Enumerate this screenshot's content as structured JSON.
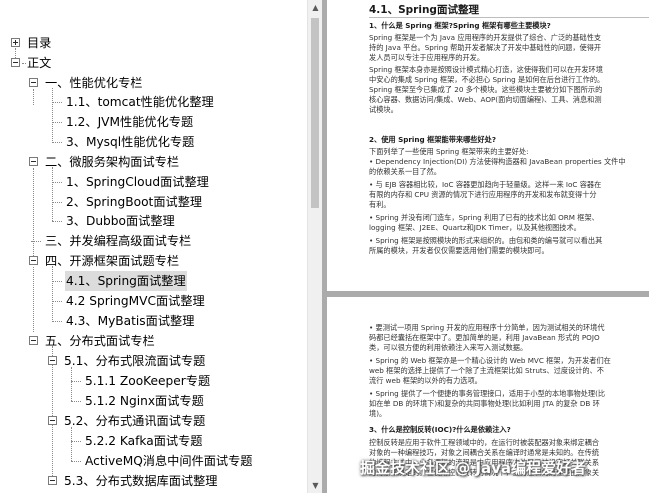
{
  "outline": {
    "items": [
      {
        "label": "目录",
        "expander": "plus",
        "selected": false
      },
      {
        "label": "正文",
        "expander": "minus",
        "selected": false
      },
      {
        "label": "一、性能优化专栏",
        "expander": "minus",
        "selected": false
      },
      {
        "label": "1.1、tomcat性能优化整理",
        "expander": "",
        "selected": false
      },
      {
        "label": "1.2、JVM性能优化专题",
        "expander": "",
        "selected": false
      },
      {
        "label": "3、Mysql性能优化专题",
        "expander": "",
        "selected": false
      },
      {
        "label": "二、微服务架构面试专栏",
        "expander": "minus",
        "selected": false
      },
      {
        "label": "1、SpringCloud面试整理",
        "expander": "",
        "selected": false
      },
      {
        "label": "2、SpringBoot面试整理",
        "expander": "",
        "selected": false
      },
      {
        "label": "3、Dubbo面试整理",
        "expander": "",
        "selected": false
      },
      {
        "label": "三、并发编程高级面试专栏",
        "expander": "",
        "selected": false
      },
      {
        "label": "四、开源框架面试题专栏",
        "expander": "minus",
        "selected": false
      },
      {
        "label": "4.1、Spring面试整理",
        "expander": "",
        "selected": true
      },
      {
        "label": "4.2 SpringMVC面试整理",
        "expander": "",
        "selected": false
      },
      {
        "label": "4.3、MyBatis面试整理",
        "expander": "",
        "selected": false
      },
      {
        "label": "五、分布式面试专栏",
        "expander": "minus",
        "selected": false
      },
      {
        "label": "5.1、分布式限流面试专题",
        "expander": "minus",
        "selected": false
      },
      {
        "label": "5.1.1 ZooKeeper专题",
        "expander": "",
        "selected": false
      },
      {
        "label": "5.1.2 Nginx面试专题",
        "expander": "",
        "selected": false
      },
      {
        "label": "5.2、分布式通讯面试专题",
        "expander": "minus",
        "selected": false
      },
      {
        "label": "5.2.2 Kafka面试专题",
        "expander": "",
        "selected": false
      },
      {
        "label": "ActiveMQ消息中间件面试专题",
        "expander": "",
        "selected": false
      },
      {
        "label": "5.3、分布式数据库面试整理",
        "expander": "minus",
        "selected": false
      }
    ]
  },
  "scrollbar": {
    "up_arrow": "▲",
    "down_arrow": "▼"
  },
  "document": {
    "top_page": {
      "lines": [
        {
          "text": "4.1、Spring面试整理",
          "style": "h1"
        },
        {
          "text": "1、什么是 Spring 框架?Spring 框架有哪些主要模块?",
          "style": "h2"
        },
        {
          "text": "Spring 框架是一个为 Java 应用程序的开发提供了综合、广泛的基础性支",
          "style": ""
        },
        {
          "text": "持的 Java 平台。Spring 帮助开发者解决了开发中基础性的问题，使得开",
          "style": ""
        },
        {
          "text": "发人员可以专注于应用程序的开发。",
          "style": ""
        },
        {
          "text": "Spring 框架本身亦是按照设计模式精心打造，这使得我们可以在开发环境",
          "style": ""
        },
        {
          "text": "中安心的集成 Spring 框架，不必担心 Spring 是如何在后台进行工作的。",
          "style": ""
        },
        {
          "text": "Spring 框架至今已集成了 20 多个模块。这些模块主要被分如下图所示的",
          "style": ""
        },
        {
          "text": "核心容器、数据访问/集成、Web、AOP(面向切面编程)、工具、消息和测",
          "style": ""
        },
        {
          "text": "试模块。",
          "style": ""
        },
        {
          "text": "2、使用 Spring 框架能带来哪些好处?",
          "style": "h2"
        },
        {
          "text": "下面列举了一些使用 Spring 框架带来的主要好处:",
          "style": ""
        },
        {
          "text": "• Dependency Injection(DI) 方法使得构造器和 JavaBean properties 文件中",
          "style": ""
        },
        {
          "text": "的依赖关系一目了然。",
          "style": ""
        },
        {
          "text": "• 与 EJB 容器相比较，IoC 容器更加趋向于轻量级。这样一来 IoC 容器在",
          "style": ""
        },
        {
          "text": "有限的内存和 CPU 资源的情况下进行应用程序的开发和发布就变得十分",
          "style": ""
        },
        {
          "text": "有利。",
          "style": ""
        },
        {
          "text": "• Spring 并没有闭门造车，Spring 利用了已有的技术比如 ORM 框架、",
          "style": ""
        },
        {
          "text": "logging 框架、J2EE、Quartz和JDK Timer，以及其他视图技术。",
          "style": ""
        },
        {
          "text": "• Spring 框架是按照模块的形式来组织的。由包和类的编号就可以看出其",
          "style": ""
        },
        {
          "text": "所属的模块，开发者仅仅需要选用他们需要的模块即可。",
          "style": ""
        }
      ]
    },
    "bottom_page": {
      "lines": [
        {
          "text": "• 要测试一项用 Spring 开发的应用程序十分简单，因为测试相关的环境代",
          "style": ""
        },
        {
          "text": "码都已经囊括在框架中了。更加简单的是，利用 JavaBean 形式的 POJO",
          "style": ""
        },
        {
          "text": "类，可以很方便的利用依赖注入来写入测试数据。",
          "style": ""
        },
        {
          "text": "• Spring 的 Web 框架亦是一个精心设计的 Web MVC 框架，为开发者们在",
          "style": ""
        },
        {
          "text": "web 框架的选择上提供了一个除了主流框架比如 Struts、过度设计的、不",
          "style": ""
        },
        {
          "text": "流行 web 框架的以外的有力选项。",
          "style": ""
        },
        {
          "text": "• Spring 提供了一个便捷的事务管理接口，适用于小型的本地事物处理(比",
          "style": ""
        },
        {
          "text": "如在单 DB 的环境下)和复杂的共同事物处理(比如利用 JTA 的复杂 DB 环",
          "style": ""
        },
        {
          "text": "境)。",
          "style": ""
        },
        {
          "text": "3、什么是控制反转(IOC)?什么是依赖注入?",
          "style": "h2"
        },
        {
          "text": "控制反转是应用于软件工程领域中的，在运行时被装配器对象来绑定耦合",
          "style": ""
        },
        {
          "text": "对象的一种编程技巧，对象之间耦合关系在编译时通常是未知的。在传统",
          "style": ""
        },
        {
          "text": "的编程方式中，业务逻辑的流程是由应用程序中的早已被设定好关联关系",
          "style": ""
        },
        {
          "text": "的对象来决定的。在使用控制反转的情况下，业务逻辑的流程是由对象关",
          "style": ""
        }
      ]
    }
  },
  "watermark": "掘金技术社区 @ Java编程爱好者"
}
